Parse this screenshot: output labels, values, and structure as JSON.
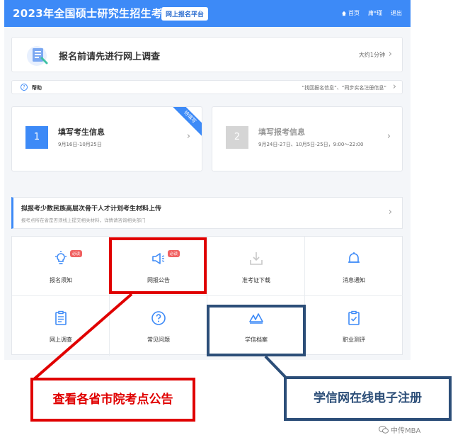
{
  "header": {
    "title": "2023年全国硕士研究生招生考试",
    "badge": "网上报名平台",
    "nav": {
      "home": "首页",
      "user": "庸*瑾",
      "logout": "退出"
    }
  },
  "survey": {
    "text": "报名前请先进行网上调查",
    "time": "大约1分钟"
  },
  "help": {
    "label": "帮助",
    "links": "“找回报名信息”、“同步实名注册信息”"
  },
  "steps": [
    {
      "num": "1",
      "name": "填写考生信息",
      "date": "9月16日-10月25日",
      "ribbon": "待填写"
    },
    {
      "num": "2",
      "name": "填写报考信息",
      "date": "9月24日-27日、10月5日-25日，9:00～22:00"
    }
  ],
  "notice": {
    "title": "拟报考少数民族高层次骨干人才计划考生材料上传",
    "sub": "报考点所在省是否须线上提交相关材料，详情请咨询相关部门"
  },
  "grid": {
    "items": [
      {
        "label": "报名须知",
        "icon": "lightbulb-icon",
        "badge": "必读"
      },
      {
        "label": "网报公告",
        "icon": "megaphone-icon",
        "badge": "必读"
      },
      {
        "label": "准考证下载",
        "icon": "download-icon"
      },
      {
        "label": "消息通知",
        "icon": "bell-icon"
      },
      {
        "label": "网上调查",
        "icon": "clipboard-icon"
      },
      {
        "label": "常见问题",
        "icon": "question-icon"
      },
      {
        "label": "学信档案",
        "icon": "xuexin-logo-icon"
      },
      {
        "label": "职业测评",
        "icon": "checklist-icon"
      }
    ]
  },
  "annotations": {
    "red": "查看各省市院考点公告",
    "blue": "学信网在线电子注册"
  },
  "watermark": "中传MBA",
  "colors": {
    "primary": "#3d8af7",
    "annotation_red": "#e00000",
    "annotation_blue": "#2c4e78",
    "badge_red": "#f06161"
  }
}
